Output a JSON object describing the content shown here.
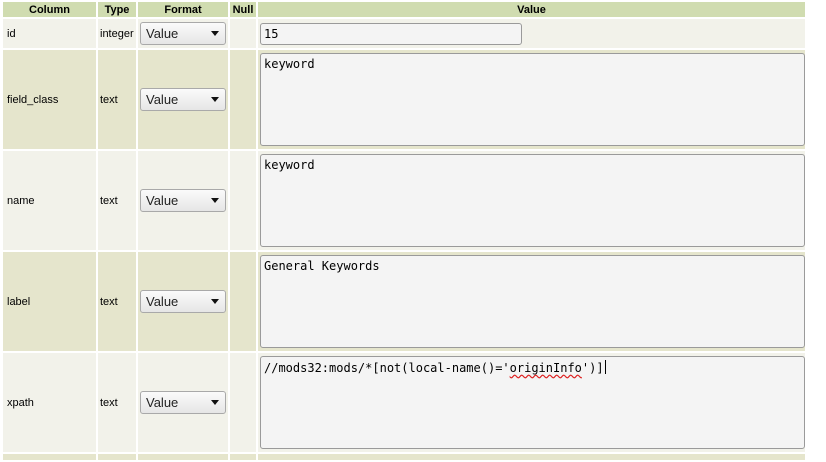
{
  "headers": {
    "column": "Column",
    "type": "Type",
    "format": "Format",
    "null": "Null",
    "value": "Value"
  },
  "rows": [
    {
      "column": "id",
      "type": "integer",
      "format": "Value",
      "value": "15"
    },
    {
      "column": "field_class",
      "type": "text",
      "format": "Value",
      "value": "keyword"
    },
    {
      "column": "name",
      "type": "text",
      "format": "Value",
      "value": "keyword"
    },
    {
      "column": "label",
      "type": "text",
      "format": "Value",
      "value": "General Keywords"
    },
    {
      "column": "xpath",
      "type": "text",
      "format": "Value",
      "value_prefix": "//mods32:mods/*[not(local-name()='",
      "value_misspelled": "originInfo",
      "value_suffix": "')]"
    }
  ],
  "icons": {
    "dropdown": "chevron-down-icon"
  }
}
